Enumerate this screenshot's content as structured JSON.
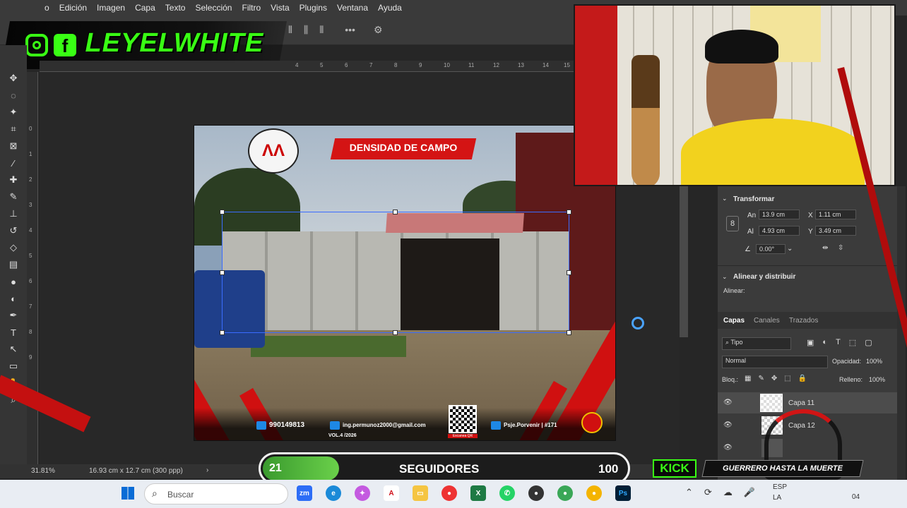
{
  "menu": [
    "o",
    "Edición",
    "Imagen",
    "Capa",
    "Texto",
    "Selección",
    "Filtro",
    "Vista",
    "Plugins",
    "Ventana",
    "Ayuda"
  ],
  "overlay": {
    "brand": "LEYELWHITE",
    "followers_label": "SEGUIDORES",
    "followers_current": "21",
    "followers_goal": "100",
    "followers_progress": 0.21,
    "kick_label": "KICK",
    "kick_channel": "GUERRERO HASTA LA MUERTE",
    "accent_green": "#39ff14",
    "accent_red": "#e01010"
  },
  "ruler_ticks": [
    "4",
    "5",
    "6",
    "7",
    "8",
    "9",
    "10",
    "11",
    "12",
    "13",
    "14",
    "15"
  ],
  "ruler_ticks_left": [
    "0",
    "1",
    "2",
    "3",
    "4",
    "5",
    "6",
    "7",
    "8",
    "9"
  ],
  "canvas": {
    "title": "DENSIDAD DE CAMPO",
    "phone": "990149813",
    "email": "ing.permunoz2000@gmail.com",
    "address": "Psje.Porvenir | #171",
    "volume": "VOL.4 /2026",
    "qr_caption": "Escanea QR"
  },
  "status": {
    "zoom": "31.81%",
    "doc_size": "16.93 cm x 12.7 cm (300 ppp)"
  },
  "properties": {
    "transform_title": "Transformar",
    "an_label": "An",
    "an_value": "13.9 cm",
    "x_label": "X",
    "x_value": "1.11 cm",
    "al_label": "Al",
    "al_value": "4.93 cm",
    "y_label": "Y",
    "y_value": "3.49 cm",
    "angle_value": "0.00°",
    "align_title": "Alinear y distribuir",
    "align_label": "Alinear:"
  },
  "layers": {
    "tabs": [
      "Capas",
      "Canales",
      "Trazados"
    ],
    "filter": "Tipo",
    "blend_mode": "Normal",
    "opacity_label": "Opacidad:",
    "opacity_value": "100%",
    "lock_label": "Bloq.:",
    "fill_label": "Relleno:",
    "fill_value": "100%",
    "items": [
      "Capa 11",
      "Capa 12",
      ""
    ]
  },
  "taskbar": {
    "search_placeholder": "Buscar",
    "lang": "ESP",
    "lang2": "LA",
    "time": "04"
  }
}
